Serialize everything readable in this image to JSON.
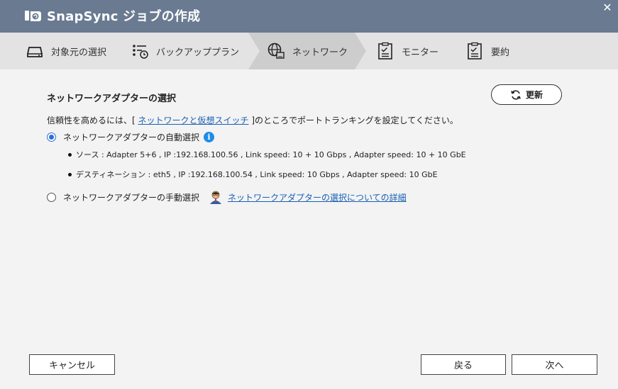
{
  "window": {
    "title": "SnapSync ジョブの作成",
    "close_label": "✕"
  },
  "steps": [
    {
      "label": "対象元の選択",
      "icon": "drive-icon",
      "active": false
    },
    {
      "label": "バックアッププラン",
      "icon": "backup-plan-icon",
      "active": false
    },
    {
      "label": "ネットワーク",
      "icon": "network-icon",
      "active": true
    },
    {
      "label": "モニター",
      "icon": "clipboard-check-icon",
      "active": false
    },
    {
      "label": "要約",
      "icon": "clipboard-check-icon",
      "active": false
    }
  ],
  "main": {
    "section_title": "ネットワークアダプターの選択",
    "refresh_label": "更新",
    "hint_prefix": "信頼性を高めるには、[ ",
    "hint_link": "ネットワークと仮想スイッチ",
    "hint_suffix": " ]のところでポートトランキングを設定してください。",
    "auto_option": {
      "label": "ネットワークアダプターの自動選択",
      "checked": true
    },
    "source_line": "ソース : Adapter 5+6 , IP :192.168.100.56 , Link speed: 10 + 10 Gbps , Adapter speed: 10 + 10 GbE",
    "dest_line": "デスティネーション : eth5 , IP :192.168.100.54 , Link speed: 10 Gbps , Adapter speed: 10 GbE",
    "manual_option": {
      "label": "ネットワークアダプターの手動選択",
      "checked": false
    },
    "detail_link": "ネットワークアダプターの選択についての詳細"
  },
  "footer": {
    "cancel_label": "キャンセル",
    "back_label": "戻る",
    "next_label": "次へ"
  },
  "colors": {
    "titlebar": "#697a91",
    "accent": "#2a6fdb",
    "link": "#1a5fb4"
  }
}
